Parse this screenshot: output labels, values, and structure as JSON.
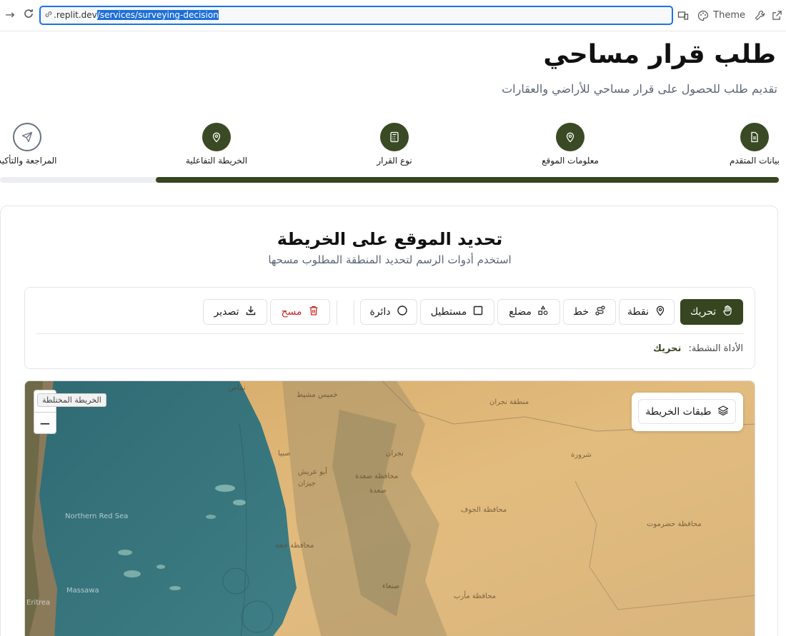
{
  "browser": {
    "url_prefix": ".replit.dev",
    "url_selected": "/services/surveying-decision",
    "theme_label": "Theme"
  },
  "header": {
    "title": "طلب قرار مساحي",
    "subtitle": "تقديم طلب للحصول على قرار مساحي للأراضي والعقارات"
  },
  "stepper": {
    "progress": 0.8,
    "steps": [
      {
        "label": "بيانات المتقدم",
        "icon": "document-icon",
        "state": "done"
      },
      {
        "label": "معلومات الموقع",
        "icon": "map-pin-icon",
        "state": "done"
      },
      {
        "label": "نوع القرار",
        "icon": "calculator-icon",
        "state": "done"
      },
      {
        "label": "الخريطة التفاعلية",
        "icon": "map-pin-icon",
        "state": "current"
      },
      {
        "label": "المراجعة والتأكيد",
        "icon": "send-icon",
        "state": "pending"
      }
    ]
  },
  "card": {
    "title": "تحديد الموقع على الخريطة",
    "subtitle": "استخدم أدوات الرسم لتحديد المنطقة المطلوب مسحها"
  },
  "tools": {
    "move": "تحريك",
    "point": "نقطة",
    "line": "خط",
    "polygon": "مضلع",
    "rectangle": "مستطيل",
    "circle": "دائرة",
    "clear": "مسح",
    "export": "تصدير",
    "active_label": "الأداة النشطة:",
    "active_value": "تحريك"
  },
  "map": {
    "zoom_in": "+",
    "zoom_out": "−",
    "map_type_tooltip": "الخريطة المختلطة",
    "layers_label": "طبقات الخريطة",
    "place_labels": [
      "منطقة نجران",
      "شرورة",
      "نجران",
      "محافظة صعدة",
      "صعدة",
      "محافظة الجوف",
      "محافظة حضرموت",
      "جيزان",
      "أبو عريش",
      "صبيا",
      "محافظة حجة",
      "صنعاء",
      "محافظة مأرب",
      "خميس مشيط",
      "نماص",
      "Eritrea",
      "Massawa",
      "Northern Red Sea"
    ]
  },
  "colors": {
    "accent": "#374520",
    "danger": "#c62828",
    "sea": "#3d7a82",
    "desert": "#d9b072"
  }
}
